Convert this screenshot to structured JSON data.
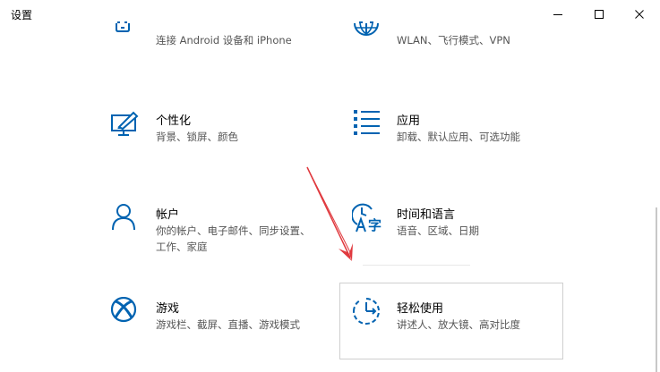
{
  "window": {
    "title": "设置"
  },
  "colors": {
    "accent": "#0063b1",
    "annotation_arrow": "#e0393e"
  },
  "tiles": [
    {
      "title": "",
      "desc": "连接 Android 设备和 iPhone",
      "icon": "phone-icon"
    },
    {
      "title": "",
      "desc": "WLAN、飞行模式、VPN",
      "icon": "globe-icon"
    },
    {
      "title": "个性化",
      "desc": "背景、锁屏、颜色",
      "icon": "personalization-icon"
    },
    {
      "title": "应用",
      "desc": "卸载、默认应用、可选功能",
      "icon": "apps-list-icon"
    },
    {
      "title": "帐户",
      "desc": "你的帐户、电子邮件、同步设置、工作、家庭",
      "icon": "person-icon"
    },
    {
      "title": "时间和语言",
      "desc": "语音、区域、日期",
      "icon": "time-language-icon"
    },
    {
      "title": "游戏",
      "desc": "游戏栏、截屏、直播、游戏模式",
      "icon": "xbox-icon"
    },
    {
      "title": "轻松使用",
      "desc": "讲述人、放大镜、高对比度",
      "icon": "ease-of-access-icon"
    }
  ]
}
